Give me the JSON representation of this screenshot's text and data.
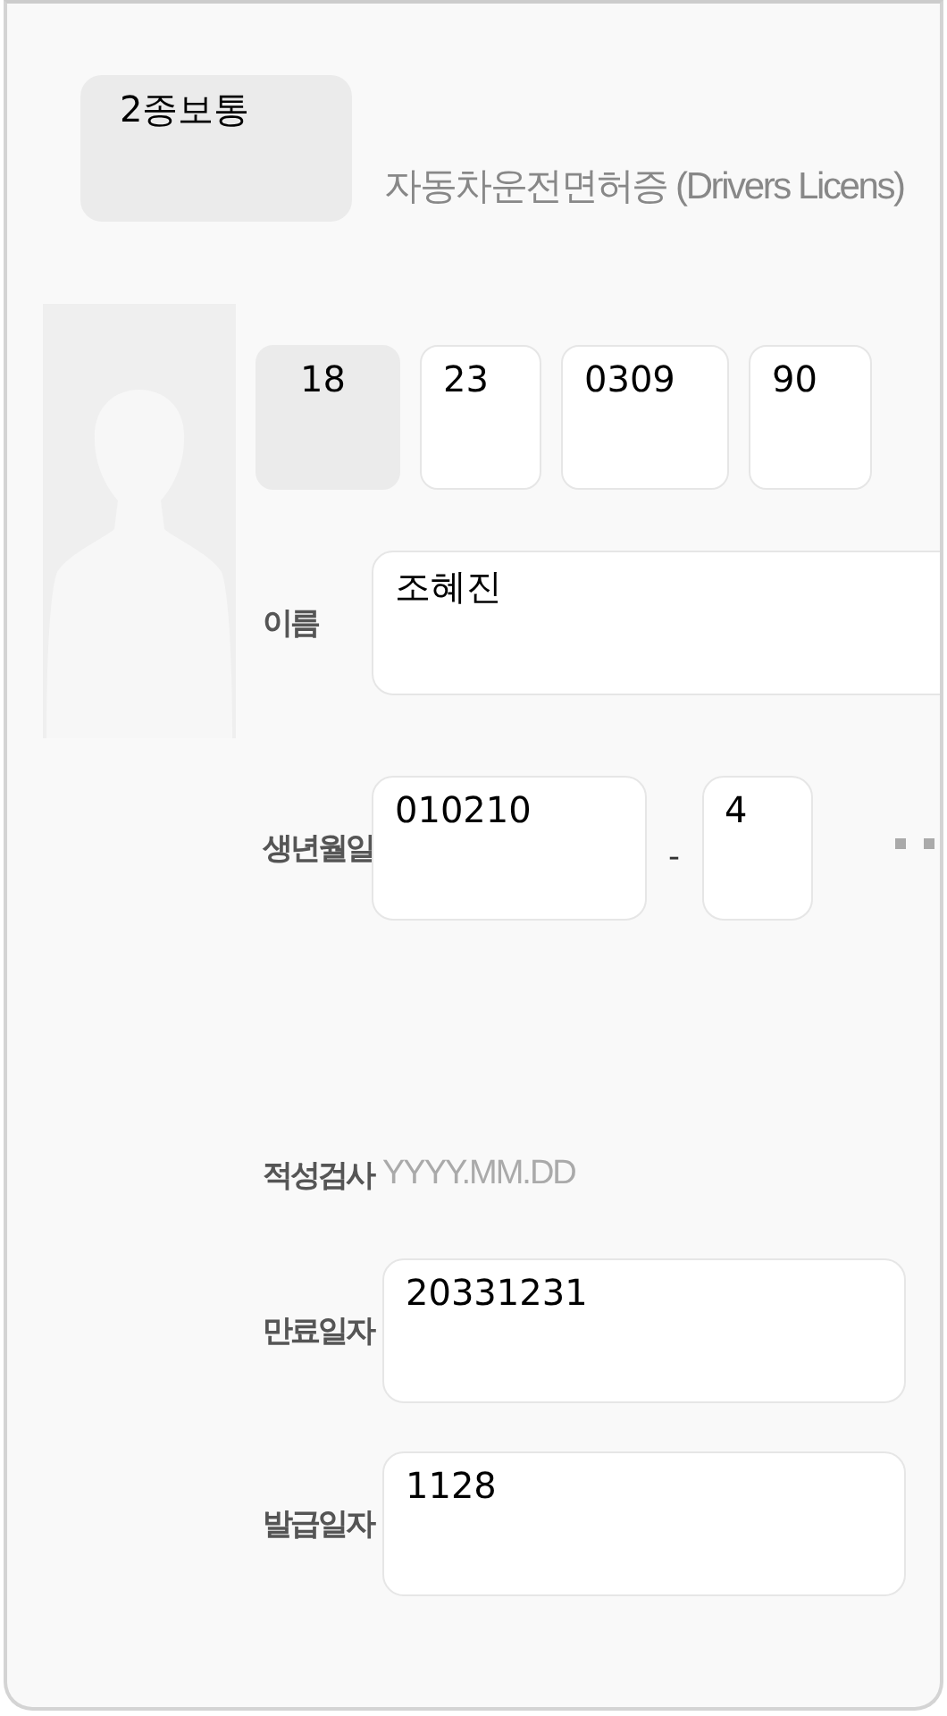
{
  "license_type": "2종보통",
  "title": "자동차운전면허증 (Drivers Licens)",
  "license_number": [
    {
      "value": "18",
      "disabled": true
    },
    {
      "value": "23",
      "disabled": false
    },
    {
      "value": "0309",
      "disabled": false
    },
    {
      "value": "90",
      "disabled": false
    }
  ],
  "fields": [
    {
      "kind": "wide",
      "label": "이름",
      "value": "조혜진"
    },
    {
      "kind": "split",
      "label": "생년월일",
      "value": "010210",
      "separator": "-",
      "suffix": "4",
      "masked": true
    },
    {
      "kind": "empty",
      "label": "적성검사",
      "placeholder": "YYYY.MM.DD"
    },
    {
      "kind": "text",
      "label": "만료일자",
      "value": "20331231"
    },
    {
      "kind": "text",
      "label": "발급일자",
      "value": "1128"
    }
  ]
}
